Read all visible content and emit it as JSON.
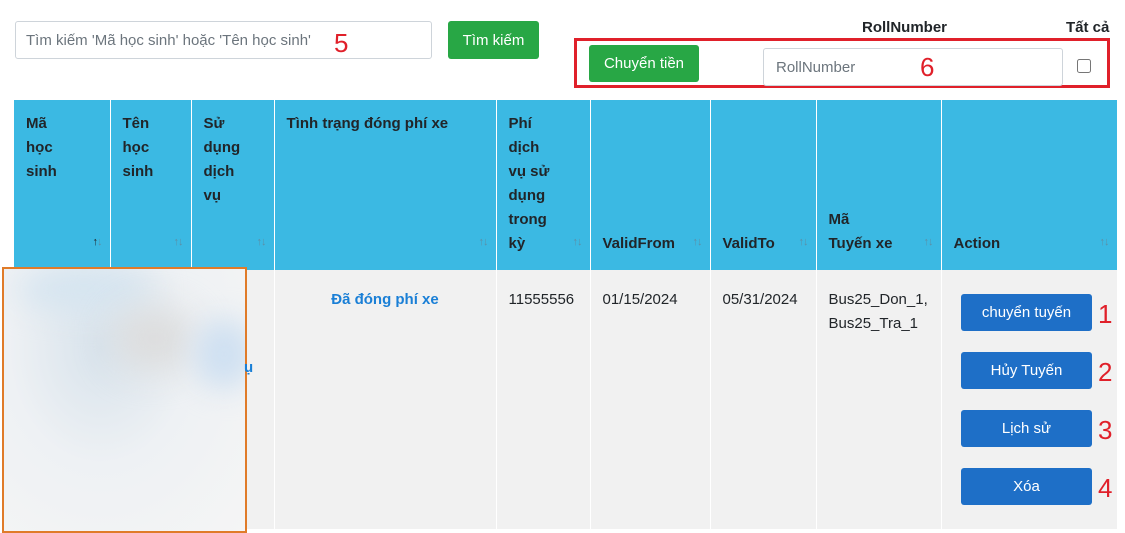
{
  "search": {
    "placeholder": "Tìm kiếm 'Mã học sinh' hoặc 'Tên học sinh'",
    "button_label": "Tìm kiếm"
  },
  "transfer_panel": {
    "rollnumber_label": "RollNumber",
    "all_label": "Tất cả",
    "transfer_button_label": "Chuyển tiền",
    "rollnumber_placeholder": "RollNumber",
    "all_checked": false
  },
  "annotations": [
    "1",
    "2",
    "3",
    "4",
    "5",
    "6"
  ],
  "table": {
    "headers": [
      "Mã học sinh",
      "Tên học sinh",
      "Sử dụng dịch vụ",
      "Tình trạng đóng phí xe",
      "Phí dịch vụ sử dụng trong kỳ",
      "ValidFrom",
      "ValidTo",
      "Mã Tuyến xe",
      "Action"
    ],
    "row": {
      "service_partial": "ụ",
      "fee_status": "Đã đóng phí xe",
      "fee": "11555556",
      "valid_from": "01/15/2024",
      "valid_to": "05/31/2024",
      "routes": "Bus25_Don_1, Bus25_Tra_1"
    },
    "actions": [
      "chuyển tuyến",
      "Hủy Tuyến",
      "Lịch sử",
      "Xóa"
    ]
  },
  "colors": {
    "header_bg": "#3bb9e3",
    "green_button": "#28a745",
    "blue_button": "#1e6fc7",
    "annotation_red": "#e0202a",
    "highlight_orange": "#e07b29"
  }
}
